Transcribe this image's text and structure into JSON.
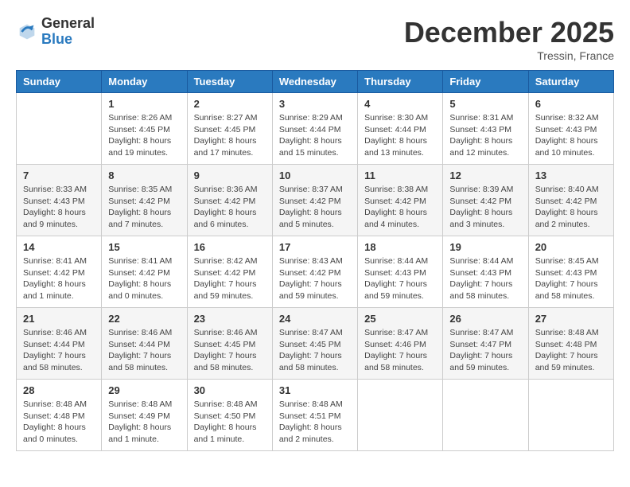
{
  "header": {
    "logo_general": "General",
    "logo_blue": "Blue",
    "month_title": "December 2025",
    "location": "Tressin, France"
  },
  "weekdays": [
    "Sunday",
    "Monday",
    "Tuesday",
    "Wednesday",
    "Thursday",
    "Friday",
    "Saturday"
  ],
  "weeks": [
    [
      {
        "day": "",
        "info": ""
      },
      {
        "day": "1",
        "info": "Sunrise: 8:26 AM\nSunset: 4:45 PM\nDaylight: 8 hours\nand 19 minutes."
      },
      {
        "day": "2",
        "info": "Sunrise: 8:27 AM\nSunset: 4:45 PM\nDaylight: 8 hours\nand 17 minutes."
      },
      {
        "day": "3",
        "info": "Sunrise: 8:29 AM\nSunset: 4:44 PM\nDaylight: 8 hours\nand 15 minutes."
      },
      {
        "day": "4",
        "info": "Sunrise: 8:30 AM\nSunset: 4:44 PM\nDaylight: 8 hours\nand 13 minutes."
      },
      {
        "day": "5",
        "info": "Sunrise: 8:31 AM\nSunset: 4:43 PM\nDaylight: 8 hours\nand 12 minutes."
      },
      {
        "day": "6",
        "info": "Sunrise: 8:32 AM\nSunset: 4:43 PM\nDaylight: 8 hours\nand 10 minutes."
      }
    ],
    [
      {
        "day": "7",
        "info": "Sunrise: 8:33 AM\nSunset: 4:43 PM\nDaylight: 8 hours\nand 9 minutes."
      },
      {
        "day": "8",
        "info": "Sunrise: 8:35 AM\nSunset: 4:42 PM\nDaylight: 8 hours\nand 7 minutes."
      },
      {
        "day": "9",
        "info": "Sunrise: 8:36 AM\nSunset: 4:42 PM\nDaylight: 8 hours\nand 6 minutes."
      },
      {
        "day": "10",
        "info": "Sunrise: 8:37 AM\nSunset: 4:42 PM\nDaylight: 8 hours\nand 5 minutes."
      },
      {
        "day": "11",
        "info": "Sunrise: 8:38 AM\nSunset: 4:42 PM\nDaylight: 8 hours\nand 4 minutes."
      },
      {
        "day": "12",
        "info": "Sunrise: 8:39 AM\nSunset: 4:42 PM\nDaylight: 8 hours\nand 3 minutes."
      },
      {
        "day": "13",
        "info": "Sunrise: 8:40 AM\nSunset: 4:42 PM\nDaylight: 8 hours\nand 2 minutes."
      }
    ],
    [
      {
        "day": "14",
        "info": "Sunrise: 8:41 AM\nSunset: 4:42 PM\nDaylight: 8 hours\nand 1 minute."
      },
      {
        "day": "15",
        "info": "Sunrise: 8:41 AM\nSunset: 4:42 PM\nDaylight: 8 hours\nand 0 minutes."
      },
      {
        "day": "16",
        "info": "Sunrise: 8:42 AM\nSunset: 4:42 PM\nDaylight: 7 hours\nand 59 minutes."
      },
      {
        "day": "17",
        "info": "Sunrise: 8:43 AM\nSunset: 4:42 PM\nDaylight: 7 hours\nand 59 minutes."
      },
      {
        "day": "18",
        "info": "Sunrise: 8:44 AM\nSunset: 4:43 PM\nDaylight: 7 hours\nand 59 minutes."
      },
      {
        "day": "19",
        "info": "Sunrise: 8:44 AM\nSunset: 4:43 PM\nDaylight: 7 hours\nand 58 minutes."
      },
      {
        "day": "20",
        "info": "Sunrise: 8:45 AM\nSunset: 4:43 PM\nDaylight: 7 hours\nand 58 minutes."
      }
    ],
    [
      {
        "day": "21",
        "info": "Sunrise: 8:46 AM\nSunset: 4:44 PM\nDaylight: 7 hours\nand 58 minutes."
      },
      {
        "day": "22",
        "info": "Sunrise: 8:46 AM\nSunset: 4:44 PM\nDaylight: 7 hours\nand 58 minutes."
      },
      {
        "day": "23",
        "info": "Sunrise: 8:46 AM\nSunset: 4:45 PM\nDaylight: 7 hours\nand 58 minutes."
      },
      {
        "day": "24",
        "info": "Sunrise: 8:47 AM\nSunset: 4:45 PM\nDaylight: 7 hours\nand 58 minutes."
      },
      {
        "day": "25",
        "info": "Sunrise: 8:47 AM\nSunset: 4:46 PM\nDaylight: 7 hours\nand 58 minutes."
      },
      {
        "day": "26",
        "info": "Sunrise: 8:47 AM\nSunset: 4:47 PM\nDaylight: 7 hours\nand 59 minutes."
      },
      {
        "day": "27",
        "info": "Sunrise: 8:48 AM\nSunset: 4:48 PM\nDaylight: 7 hours\nand 59 minutes."
      }
    ],
    [
      {
        "day": "28",
        "info": "Sunrise: 8:48 AM\nSunset: 4:48 PM\nDaylight: 8 hours\nand 0 minutes."
      },
      {
        "day": "29",
        "info": "Sunrise: 8:48 AM\nSunset: 4:49 PM\nDaylight: 8 hours\nand 1 minute."
      },
      {
        "day": "30",
        "info": "Sunrise: 8:48 AM\nSunset: 4:50 PM\nDaylight: 8 hours\nand 1 minute."
      },
      {
        "day": "31",
        "info": "Sunrise: 8:48 AM\nSunset: 4:51 PM\nDaylight: 8 hours\nand 2 minutes."
      },
      {
        "day": "",
        "info": ""
      },
      {
        "day": "",
        "info": ""
      },
      {
        "day": "",
        "info": ""
      }
    ]
  ]
}
